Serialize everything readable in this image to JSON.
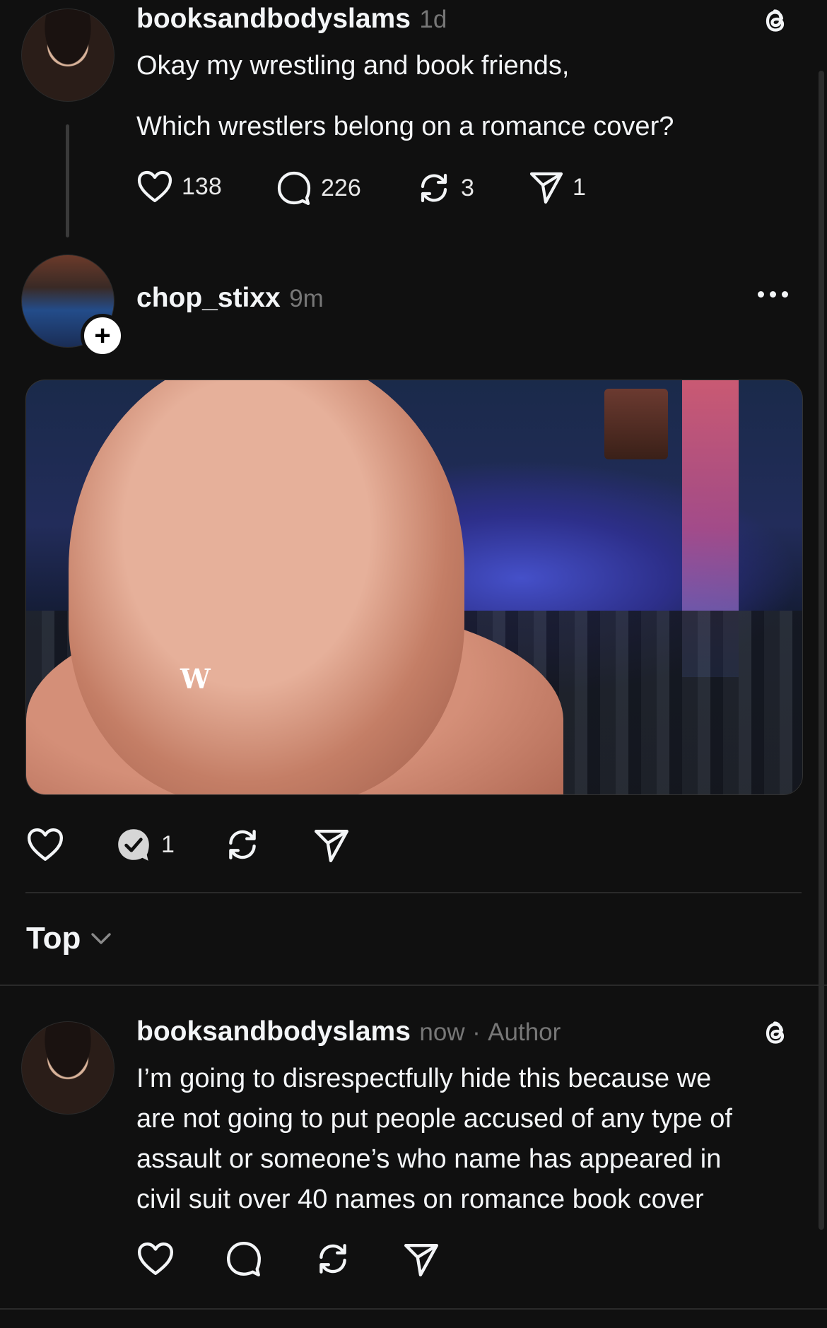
{
  "original_post": {
    "username": "booksandbodyslams",
    "time": "1d",
    "text_line1": "Okay my wrestling and book friends,",
    "text_line2": "Which wrestlers belong on a romance cover?",
    "likes": "138",
    "replies": "226",
    "reposts": "3",
    "shares": "1",
    "platform_icon": "threads-logo"
  },
  "reply_post": {
    "username": "chop_stixx",
    "time": "9m",
    "more_icon": "more-dots",
    "follow_icon": "plus",
    "follow_label": "+",
    "media_watermark": "W",
    "replies": "1"
  },
  "sort": {
    "label": "Top",
    "icon": "chevron-down"
  },
  "author_reply": {
    "username": "booksandbodyslams",
    "time": "now",
    "separator": "·",
    "badge": "Author",
    "lines": [
      "I’m going to disrespectfully hide this because we",
      "are not going to put people accused of any type of",
      "assault or someone’s who name has appeared in",
      "civil suit over 40 names on romance book cover"
    ],
    "platform_icon": "threads-logo"
  },
  "colors": {
    "background": "#101010",
    "text": "#f3f5f7",
    "muted": "#777777",
    "divider": "#2a2a2a"
  }
}
